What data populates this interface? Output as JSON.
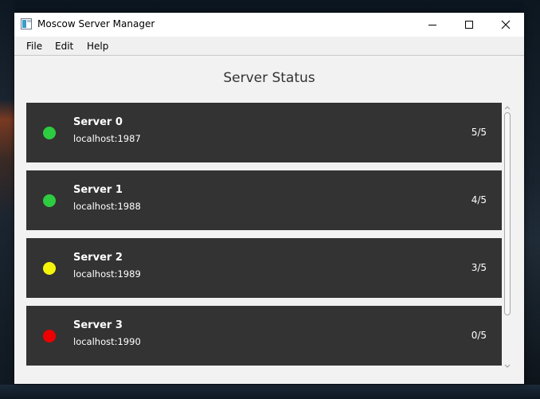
{
  "window": {
    "title": "Moscow Server Manager"
  },
  "menu": {
    "file": "File",
    "edit": "Edit",
    "help": "Help"
  },
  "main": {
    "heading": "Server Status",
    "servers": [
      {
        "name": "Server 0",
        "address": "localhost:1987",
        "count": "5/5",
        "status_color": "#2ecc40"
      },
      {
        "name": "Server 1",
        "address": "localhost:1988",
        "count": "4/5",
        "status_color": "#2ecc40"
      },
      {
        "name": "Server 2",
        "address": "localhost:1989",
        "count": "3/5",
        "status_color": "#f5f50a"
      },
      {
        "name": "Server 3",
        "address": "localhost:1990",
        "count": "0/5",
        "status_color": "#ee0000"
      }
    ]
  },
  "colors": {
    "card_bg": "#333333",
    "window_bg": "#f2f2f2",
    "text_on_card": "#ffffff"
  },
  "icons": {
    "app": "app-window-icon",
    "minimize": "minimize-icon",
    "maximize": "maximize-icon",
    "close": "close-icon",
    "scroll_up": "scroll-up-arrow-icon",
    "scroll_down": "scroll-down-arrow-icon"
  }
}
